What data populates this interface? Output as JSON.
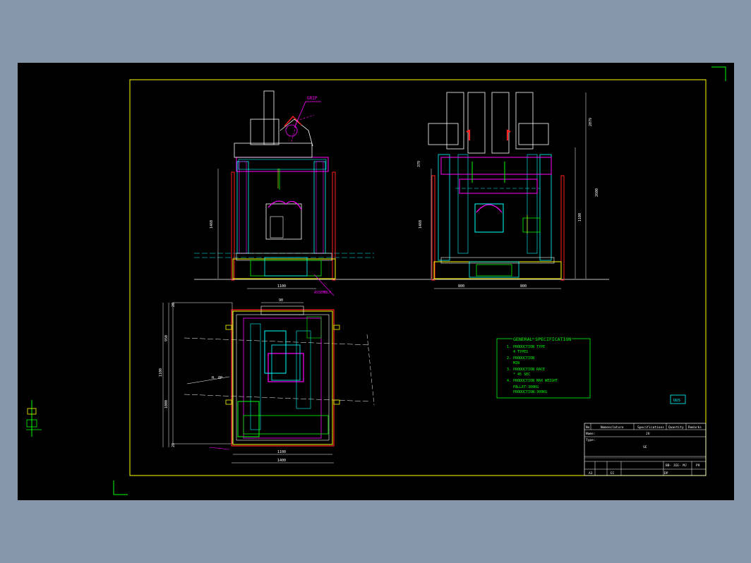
{
  "colors": {
    "app_bg": "#8796aa",
    "canvas_bg": "#000000",
    "frame": "#ffff00",
    "white": "#ffffff",
    "cyan": "#00ffff",
    "magenta": "#ff00ff",
    "red": "#ff2020",
    "green": "#00ff00",
    "yellow": "#ffff00"
  },
  "drawing": {
    "side_view": {
      "dim_height": "1460",
      "dim_width": "1100",
      "callout": "GRIP"
    },
    "front_view": {
      "dim_upper": "2079",
      "dim_total": "2600",
      "dim_mid": "1100",
      "dim_left": "1460",
      "dim_top": "379",
      "dim_bottom_left": "800",
      "dim_bottom_right": "800"
    },
    "plan_view": {
      "dim_top": "90",
      "dim_left_1": "950",
      "dim_left_2": "1100",
      "dim_left_3": "1000",
      "dim_small_top": "20",
      "dim_small_bottom": "20",
      "dim_bottom_1": "1100",
      "dim_bottom_2": "1400",
      "label_h": "H. 0P"
    },
    "spec_box": {
      "title": "GENERAL SPECIFICATION",
      "lines": [
        "1. PRODUCTION TYPE",
        "   4 TYPES",
        "2. PRODUCTION",
        "   MIN",
        "3. PRODUCTION RACE",
        "   * 45 SEC",
        "4. PRODUCTION MAX WEIGHT",
        "   PALLET:300KG",
        "   PRODUCTION:300KG"
      ]
    },
    "small_tag": "UUS",
    "title_block": {
      "headers": [
        "No",
        "Nomenclature",
        "Specifications",
        "Quantity",
        "Remarks"
      ],
      "name_label": "Name:",
      "name_value": "JU",
      "type_label": "Type:",
      "type_value": "SE",
      "drawing_no": "BB- JEE- MJ",
      "sheet": "P9",
      "scale": "A3",
      "date": "EC",
      "by": "DP"
    }
  }
}
